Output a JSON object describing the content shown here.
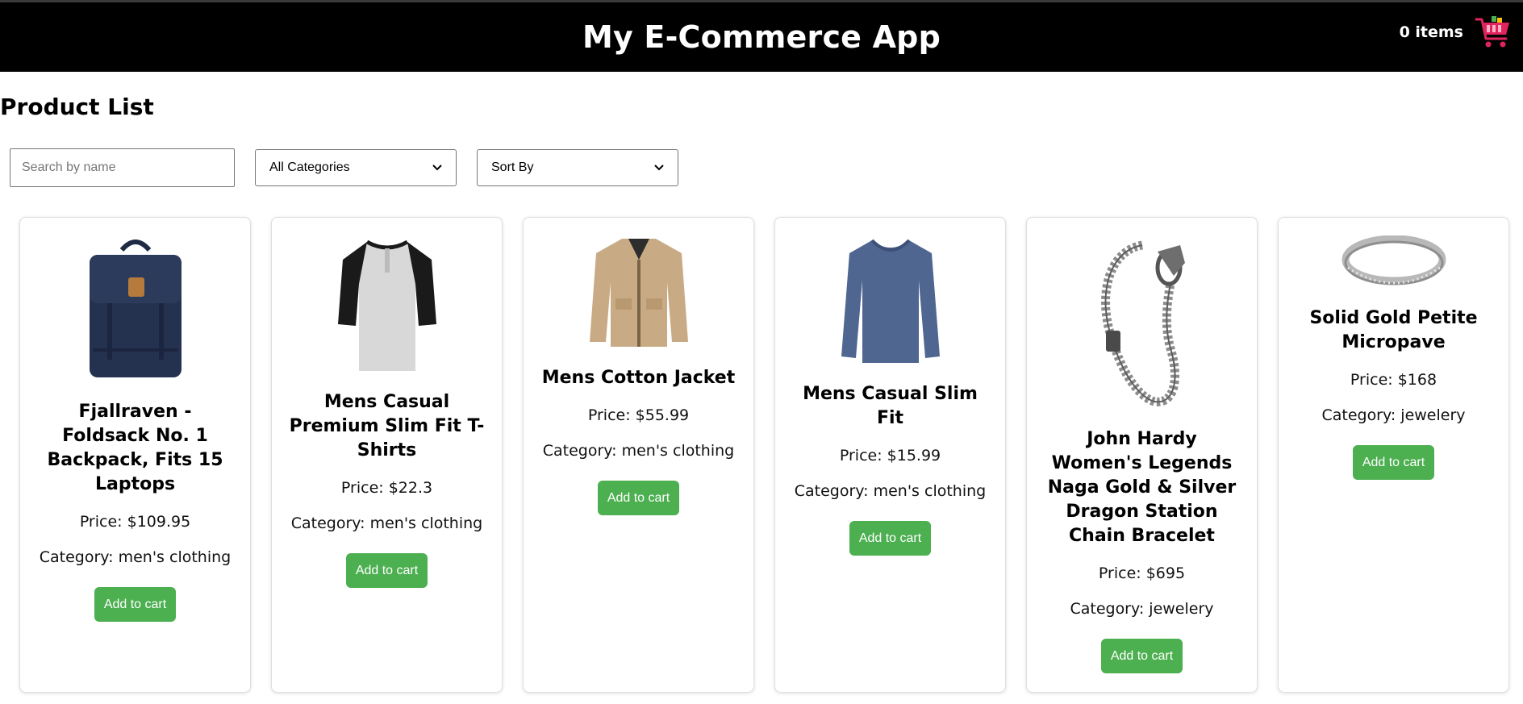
{
  "header": {
    "title": "My E-Commerce App",
    "cart_count": "0 items",
    "cart_icon": "shopping-cart-icon"
  },
  "page": {
    "heading": "Product List"
  },
  "filters": {
    "search_placeholder": "Search by name",
    "search_value": "",
    "category_selected": "All Categories",
    "sort_selected": "Sort By"
  },
  "colors": {
    "header_bg": "#000000",
    "button_bg": "#4caf50",
    "cart_icon": "#e0245e"
  },
  "products": [
    {
      "title": "Fjallraven - Foldsack No. 1 Backpack, Fits 15 Laptops",
      "price": "Price: $109.95",
      "category": "Category: men's clothing",
      "button": "Add to cart",
      "image": "backpack"
    },
    {
      "title": "Mens Casual Premium Slim Fit T-Shirts",
      "price": "Price: $22.3",
      "category": "Category: men's clothing",
      "button": "Add to cart",
      "image": "t-shirt"
    },
    {
      "title": "Mens Cotton Jacket",
      "price": "Price: $55.99",
      "category": "Category: men's clothing",
      "button": "Add to cart",
      "image": "jacket"
    },
    {
      "title": "Mens Casual Slim Fit",
      "price": "Price: $15.99",
      "category": "Category: men's clothing",
      "button": "Add to cart",
      "image": "long-sleeve-shirt"
    },
    {
      "title": "John Hardy Women's Legends Naga Gold & Silver Dragon Station Chain Bracelet",
      "price": "Price: $695",
      "category": "Category: jewelery",
      "button": "Add to cart",
      "image": "bracelet"
    },
    {
      "title": "Solid Gold Petite Micropave",
      "price": "Price: $168",
      "category": "Category: jewelery",
      "button": "Add to cart",
      "image": "ring"
    }
  ]
}
